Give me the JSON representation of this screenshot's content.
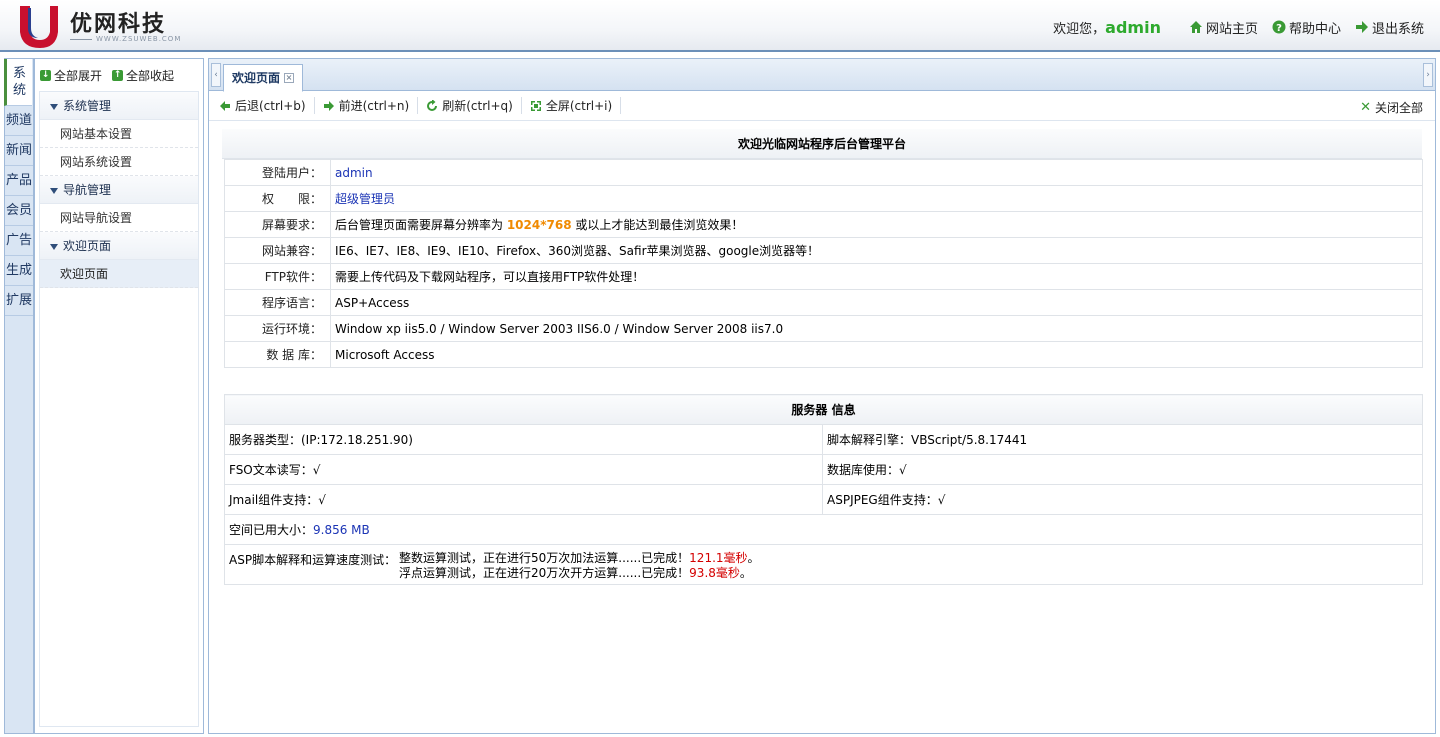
{
  "header": {
    "logo_cn": "优网科技",
    "logo_en": "WWW.ZSUWEB.COM",
    "welcome": "欢迎您，",
    "username": "admin",
    "links": [
      {
        "label": "网站主页",
        "icon": "home-icon"
      },
      {
        "label": "帮助中心",
        "icon": "help-icon"
      },
      {
        "label": "退出系统",
        "icon": "logout-icon"
      }
    ]
  },
  "vtabs": [
    {
      "label": "系统",
      "active": true
    },
    {
      "label": "频道"
    },
    {
      "label": "新闻"
    },
    {
      "label": "产品"
    },
    {
      "label": "会员"
    },
    {
      "label": "广告"
    },
    {
      "label": "生成"
    },
    {
      "label": "扩展"
    }
  ],
  "menu": {
    "expand_all": "全部展开",
    "collapse_all": "全部收起",
    "groups": [
      {
        "title": "系统管理",
        "items": [
          "网站基本设置",
          "网站系统设置"
        ]
      },
      {
        "title": "导航管理",
        "items": [
          "网站导航设置"
        ]
      },
      {
        "title": "欢迎页面",
        "items": [
          "欢迎页面"
        ]
      }
    ]
  },
  "tabs": {
    "active_tab": "欢迎页面"
  },
  "toolbar": {
    "back": "后退(ctrl+b)",
    "forward": "前进(ctrl+n)",
    "refresh": "刷新(ctrl+q)",
    "fullscreen": "全屏(ctrl+i)",
    "close_all": "关闭全部"
  },
  "welcome": {
    "title": "欢迎光临网站程序后台管理平台",
    "rows": [
      {
        "key": "登陆用户：",
        "value": "admin"
      },
      {
        "key": "权　　限：",
        "value": "超级管理员"
      },
      {
        "key": "屏幕要求：",
        "value_pre": "后台管理页面需要屏幕分辨率为 ",
        "value_hl": "1024*768",
        "value_post": " 或以上才能达到最佳浏览效果！"
      },
      {
        "key": "网站兼容：",
        "value": "IE6、IE7、IE8、IE9、IE10、Firefox、360浏览器、Safir苹果浏览器、google浏览器等！"
      },
      {
        "key": "FTP软件：",
        "value": "需要上传代码及下载网站程序，可以直接用FTP软件处理！"
      },
      {
        "key": "程序语言：",
        "value": "ASP+Access"
      },
      {
        "key": "运行环境：",
        "value": "Window xp iis5.0 / Window Server 2003 IIS6.0 / Window Server 2008 iis7.0"
      },
      {
        "key": "数 据 库：",
        "value": "Microsoft Access"
      }
    ]
  },
  "server": {
    "title": "服务器 信息",
    "server_type": "服务器类型：(IP:172.18.251.90)",
    "script_engine": "脚本解释引擎：VBScript/5.8.17441",
    "fso": "FSO文本读写：",
    "fso_val": "√",
    "db": "数据库使用：",
    "db_val": "√",
    "jmail": "Jmail组件支持：",
    "jmail_val": "√",
    "aspjpeg": "ASPJPEG组件支持：",
    "aspjpeg_val": "√",
    "space_label": "空间已用大小：",
    "space_val": "9.856 MB",
    "speed_label": "ASP脚本解释和运算速度测试：",
    "speed_int_pre": "整数运算测试，正在进行50万次加法运算......已完成！",
    "speed_int_val": "121.1毫秒",
    "speed_int_post": "。",
    "speed_float_pre": "浮点运算测试，正在进行20万次开方运算......已完成！",
    "speed_float_val": "93.8毫秒",
    "speed_float_post": "。"
  }
}
